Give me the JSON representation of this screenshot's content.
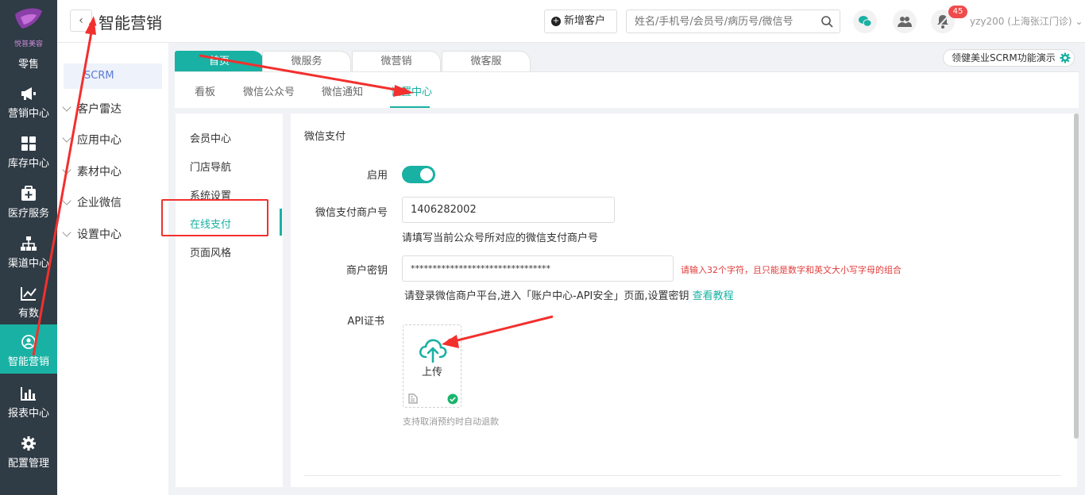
{
  "brand": {
    "logo_text": "悦普美容"
  },
  "left_nav": {
    "top_label": "零售",
    "items": [
      {
        "label": "营销中心",
        "icon": "megaphone-icon"
      },
      {
        "label": "库存中心",
        "icon": "grid-icon"
      },
      {
        "label": "医疗服务",
        "icon": "medical-kit-icon"
      },
      {
        "label": "渠道中心",
        "icon": "org-tree-icon"
      },
      {
        "label": "有数",
        "icon": "trend-chart-icon"
      },
      {
        "label": "智能营销",
        "icon": "smart-user-icon",
        "active": true
      },
      {
        "label": "报表中心",
        "icon": "bar-chart-icon"
      },
      {
        "label": "配置管理",
        "icon": "gear-icon"
      }
    ]
  },
  "submenu": {
    "crm": "SCRM",
    "groups": [
      "客户雷达",
      "应用中心",
      "素材中心",
      "企业微信",
      "设置中心"
    ]
  },
  "header": {
    "title": "智能营销",
    "add_customer": "新增客户",
    "search_placeholder": "姓名/手机号/会员号/病历号/微信号",
    "notification_count": "45",
    "user": "yzy200 (上海张江门诊)"
  },
  "tabs": [
    {
      "label": "首页",
      "active": true
    },
    {
      "label": "微服务"
    },
    {
      "label": "微营销"
    },
    {
      "label": "微客服"
    }
  ],
  "demo_button": "领健美业SCRM功能演示",
  "subtabs": [
    {
      "label": "看板"
    },
    {
      "label": "微信公众号"
    },
    {
      "label": "微信通知"
    },
    {
      "label": "设置中心",
      "active": true
    }
  ],
  "settings_menu": [
    {
      "label": "会员中心"
    },
    {
      "label": "门店导航"
    },
    {
      "label": "系统设置"
    },
    {
      "label": "在线支付",
      "active": true
    },
    {
      "label": "页面风格"
    }
  ],
  "form": {
    "section_title": "微信支付",
    "enable_label": "启用",
    "enabled": true,
    "merchant_id_label": "微信支付商户号",
    "merchant_id_value": "1406282002",
    "merchant_id_hint": "请填写当前公众号所对应的微信支付商户号",
    "key_label": "商户密钥",
    "key_value": "********************************",
    "key_error": "请输入32个字符，且只能是数字和英文大小写字母的组合",
    "key_hint": "请登录微信商户平台,进入「账户中心-API安全」页面,设置密钥",
    "key_hint_link": "查看教程",
    "cert_label": "API证书",
    "upload_label": "上传",
    "cert_note": "支持取消预约时自动退款"
  },
  "colors": {
    "accent": "#19b1a3",
    "sidebar": "#2f3b45",
    "annotation": "#f2302e"
  }
}
